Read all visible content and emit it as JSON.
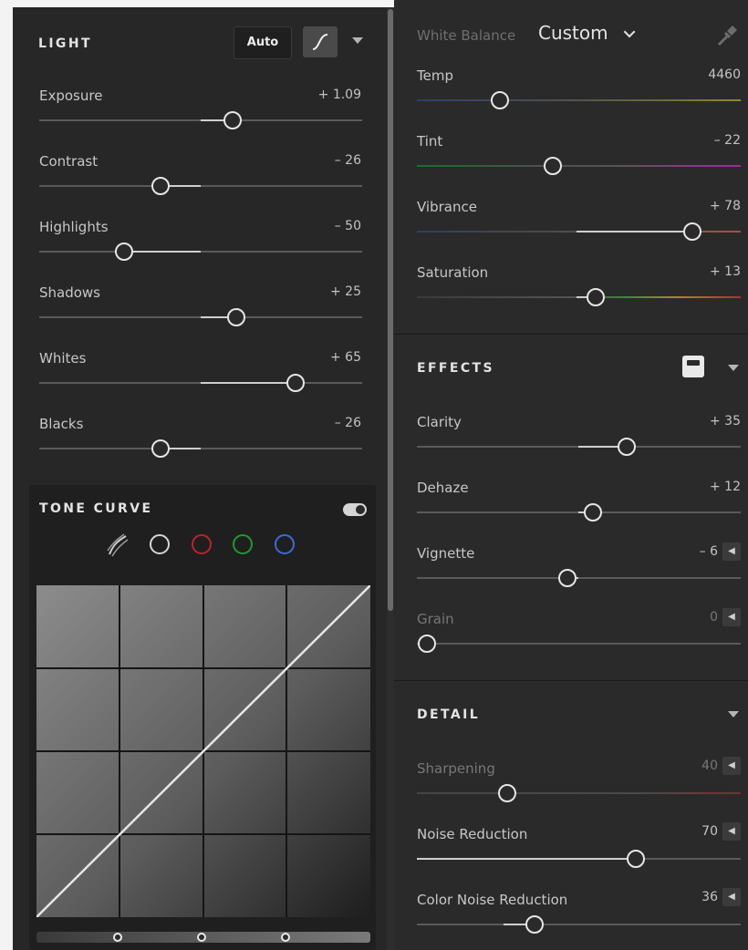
{
  "light": {
    "title": "LIGHT",
    "auto_label": "Auto",
    "sliders": [
      {
        "label": "Exposure",
        "value": "+ 1.09",
        "pos": 0.6
      },
      {
        "label": "Contrast",
        "value": "– 26",
        "pos": 0.37
      },
      {
        "label": "Highlights",
        "value": "– 50",
        "pos": 0.25
      },
      {
        "label": "Shadows",
        "value": "+ 25",
        "pos": 0.62
      },
      {
        "label": "Whites",
        "value": "+ 65",
        "pos": 0.8
      },
      {
        "label": "Blacks",
        "value": "– 26",
        "pos": 0.37
      }
    ]
  },
  "tone_curve": {
    "title": "TONE CURVE",
    "channels": [
      "parametric-curve-icon",
      "rgb-point-icon",
      "red-channel-icon",
      "green-channel-icon",
      "blue-channel-icon"
    ]
  },
  "white_balance": {
    "label": "White Balance",
    "value": "Custom"
  },
  "color": {
    "sliders": [
      {
        "label": "Temp",
        "value": "4460",
        "pos": 0.25
      },
      {
        "label": "Tint",
        "value": "– 22",
        "pos": 0.42
      },
      {
        "label": "Vibrance",
        "value": "+ 78",
        "pos": 0.87
      },
      {
        "label": "Saturation",
        "value": "+ 13",
        "pos": 0.56
      }
    ]
  },
  "effects": {
    "title": "EFFECTS",
    "sliders": [
      {
        "label": "Clarity",
        "value": "+ 35",
        "pos": 0.67
      },
      {
        "label": "Dehaze",
        "value": "+ 12",
        "pos": 0.55
      },
      {
        "label": "Vignette",
        "value": "– 6",
        "pos": 0.47
      },
      {
        "label": "Grain",
        "value": "0",
        "pos": 0.0
      }
    ]
  },
  "detail": {
    "title": "DETAIL",
    "sliders": [
      {
        "label": "Sharpening",
        "value": "40",
        "pos": 0.28
      },
      {
        "label": "Noise Reduction",
        "value": "70",
        "pos": 0.7
      },
      {
        "label": "Color Noise Reduction",
        "value": "36",
        "pos": 0.36
      }
    ]
  },
  "colors": {
    "panel_bg": "#2a2a2a",
    "knob": "#e6e6e6",
    "red_channel": "#c0202a",
    "green_channel": "#1e9a2e",
    "blue_channel": "#3c6bd8"
  }
}
